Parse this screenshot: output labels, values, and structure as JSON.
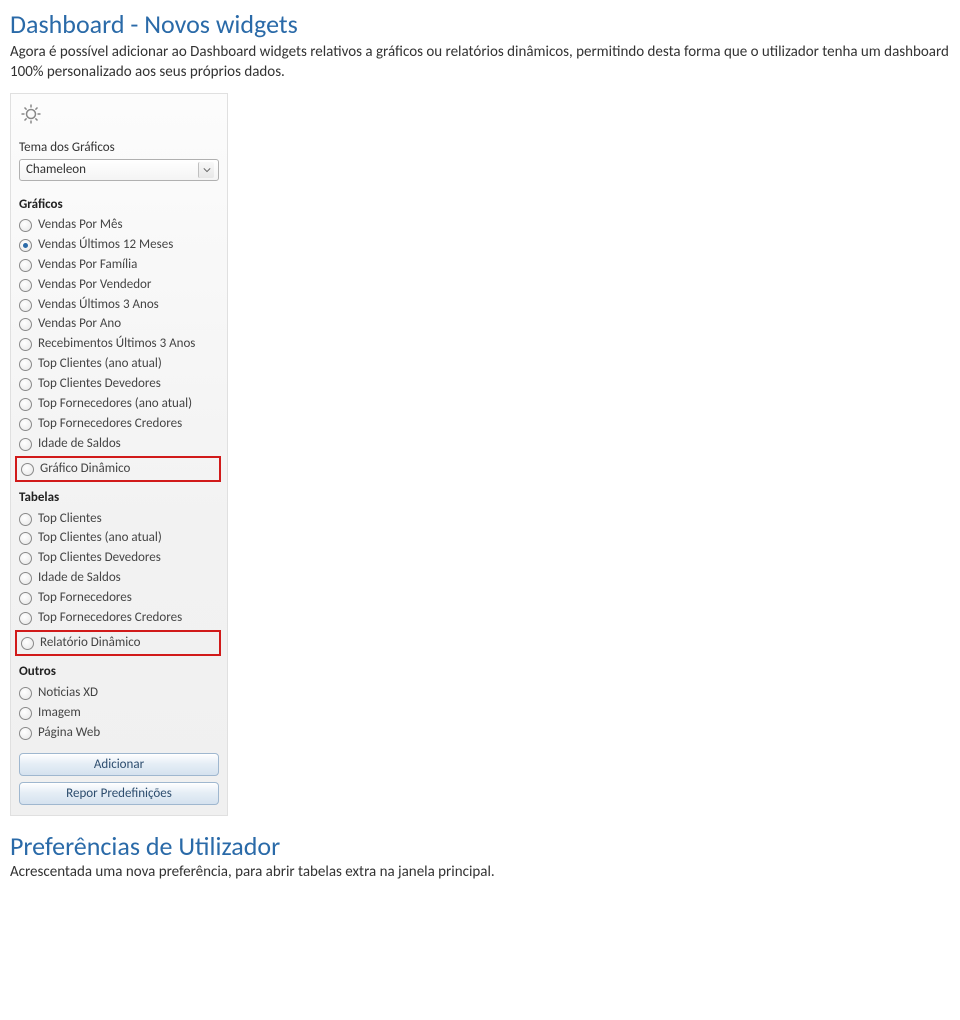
{
  "doc": {
    "heading1": "Dashboard - Novos widgets",
    "paragraph1": "Agora é possível adicionar ao Dashboard widgets relativos a gráficos ou relatórios dinâmicos, permitindo desta forma que o utilizador tenha um dashboard 100% personalizado aos seus próprios dados.",
    "heading2": "Preferências de Utilizador",
    "paragraph2": "Acrescentada uma nova preferência, para abrir tabelas extra na janela principal."
  },
  "panel": {
    "theme_label": "Tema dos Gráficos",
    "theme_selected": "Chameleon",
    "graficos_header": "Gráficos",
    "graficos_items": [
      {
        "label": "Vendas Por Mês",
        "selected": false
      },
      {
        "label": "Vendas Últimos 12 Meses",
        "selected": true
      },
      {
        "label": "Vendas Por Família",
        "selected": false
      },
      {
        "label": "Vendas Por Vendedor",
        "selected": false
      },
      {
        "label": "Vendas Últimos 3 Anos",
        "selected": false
      },
      {
        "label": "Vendas Por Ano",
        "selected": false
      },
      {
        "label": "Recebimentos Últimos 3 Anos",
        "selected": false
      },
      {
        "label": "Top Clientes (ano atual)",
        "selected": false
      },
      {
        "label": "Top Clientes Devedores",
        "selected": false
      },
      {
        "label": "Top Fornecedores (ano atual)",
        "selected": false
      },
      {
        "label": "Top Fornecedores Credores",
        "selected": false
      },
      {
        "label": "Idade de Saldos",
        "selected": false
      }
    ],
    "graficos_highlight": {
      "label": "Gráfico Dinâmico",
      "selected": false
    },
    "tabelas_header": "Tabelas",
    "tabelas_items": [
      {
        "label": "Top Clientes",
        "selected": false
      },
      {
        "label": "Top Clientes (ano atual)",
        "selected": false
      },
      {
        "label": "Top Clientes Devedores",
        "selected": false
      },
      {
        "label": "Idade de Saldos",
        "selected": false
      },
      {
        "label": "Top Fornecedores",
        "selected": false
      },
      {
        "label": "Top Fornecedores Credores",
        "selected": false
      }
    ],
    "tabelas_highlight": {
      "label": "Relatório Dinâmico",
      "selected": false
    },
    "outros_header": "Outros",
    "outros_items": [
      {
        "label": "Noticias XD",
        "selected": false
      },
      {
        "label": "Imagem",
        "selected": false
      },
      {
        "label": "Página Web",
        "selected": false
      }
    ],
    "button_add": "Adicionar",
    "button_reset": "Repor Predefinições"
  }
}
